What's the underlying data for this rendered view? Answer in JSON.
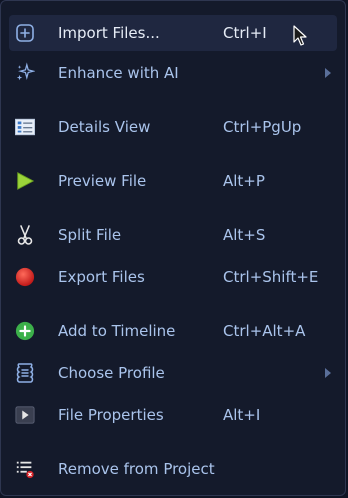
{
  "menu": {
    "items": [
      {
        "label": "Import Files...",
        "shortcut": "Ctrl+I",
        "icon": "import-file-icon"
      },
      {
        "label": "Enhance with AI",
        "shortcut": "",
        "icon": "sparkles-icon",
        "submenu": true
      },
      {
        "label": "Details View",
        "shortcut": "Ctrl+PgUp",
        "icon": "details-view-icon"
      },
      {
        "label": "Preview File",
        "shortcut": "Alt+P",
        "icon": "play-icon"
      },
      {
        "label": "Split File",
        "shortcut": "Alt+S",
        "icon": "scissors-icon"
      },
      {
        "label": "Export Files",
        "shortcut": "Ctrl+Shift+E",
        "icon": "record-icon"
      },
      {
        "label": "Add to Timeline",
        "shortcut": "Ctrl+Alt+A",
        "icon": "add-circle-icon"
      },
      {
        "label": "Choose Profile",
        "shortcut": "",
        "icon": "profile-icon",
        "submenu": true
      },
      {
        "label": "File Properties",
        "shortcut": "Alt+I",
        "icon": "properties-icon"
      },
      {
        "label": "Remove from Project",
        "shortcut": "",
        "icon": "remove-list-icon"
      }
    ]
  },
  "colors": {
    "background": "#141a2b",
    "hover": "#1f2740",
    "text": "#aac4ec",
    "accent_green": "#3cb04a",
    "accent_red": "#d8252a"
  }
}
